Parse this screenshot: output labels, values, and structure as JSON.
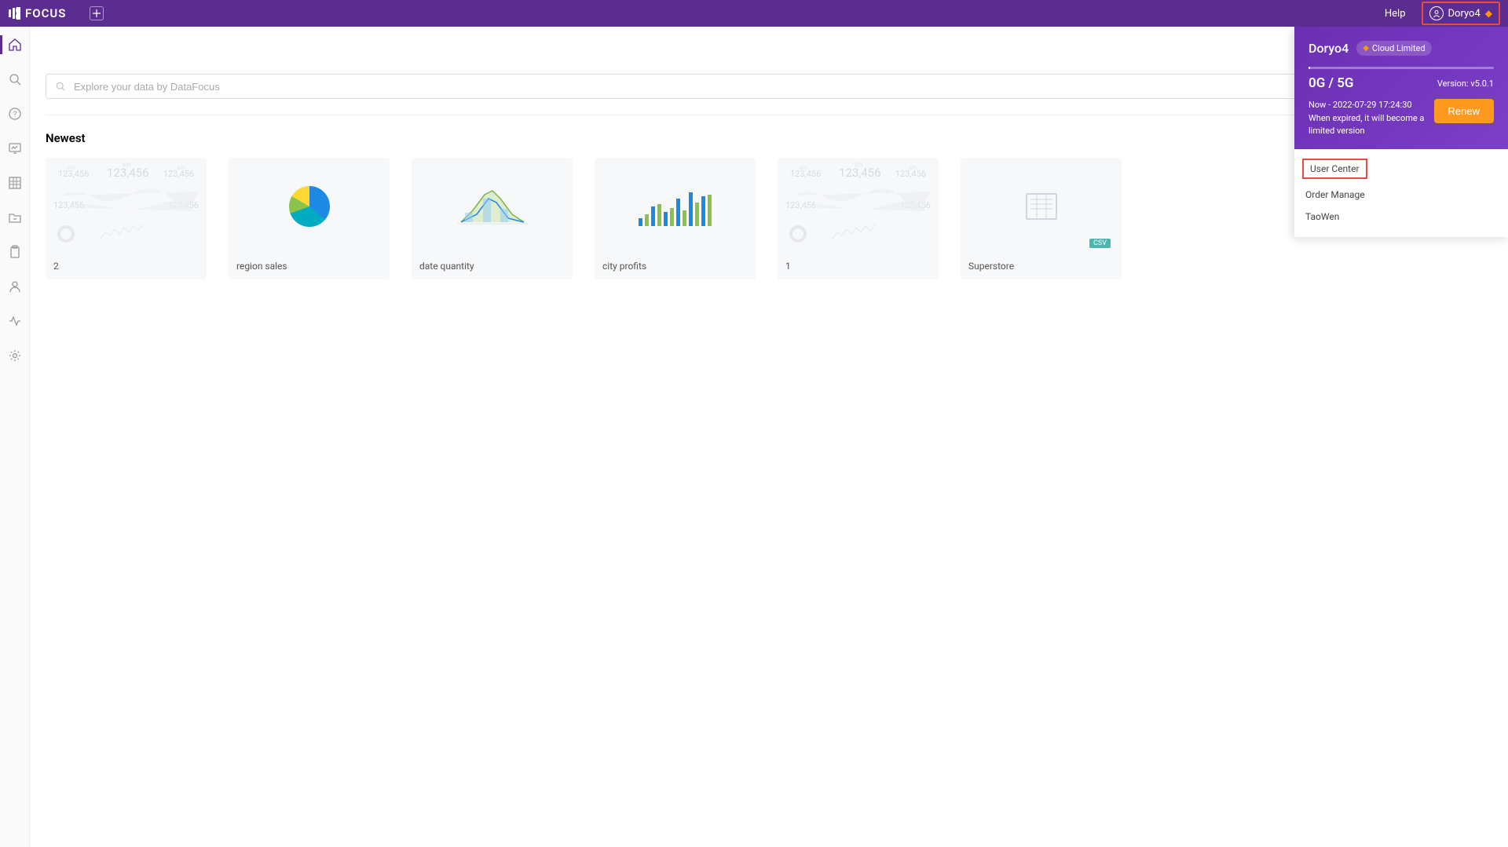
{
  "header": {
    "brand": "FOCUS",
    "help_label": "Help",
    "username": "Doryo4"
  },
  "search": {
    "placeholder": "Explore your data by DataFocus"
  },
  "section_title": "Newest",
  "cards": [
    {
      "title": "2"
    },
    {
      "title": "region sales"
    },
    {
      "title": "date quantity"
    },
    {
      "title": "city profits"
    },
    {
      "title": "1"
    },
    {
      "title": "Superstore"
    }
  ],
  "user_panel": {
    "username": "Doryo4",
    "plan": "Cloud Limited",
    "storage": "0G / 5G",
    "version_label": "Version:",
    "version": "v5.0.1",
    "expiry_line1": "Now - 2022-07-29 17:24:30",
    "expiry_line2": "When expired, it will become a limited version",
    "renew_label": "Renew",
    "menu": {
      "user_center": "User Center",
      "order_manage": "Order Manage",
      "taowen": "TaoWen"
    }
  },
  "kpi_placeholder": "123,456",
  "kpi_small_label": "KPI",
  "csv_label": "CSV"
}
